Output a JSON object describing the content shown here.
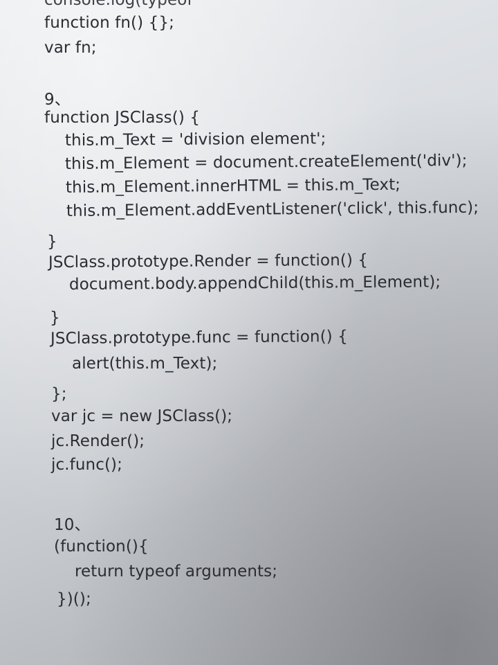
{
  "code_lines": [
    "console.log(typeof",
    "function fn() {};",
    "var fn;",
    "9、",
    "function JSClass() {",
    "this.m_Text = 'division element';",
    "this.m_Element = document.createElement('div');",
    "this.m_Element.innerHTML = this.m_Text;",
    "this.m_Element.addEventListener('click', this.func);",
    "}",
    "JSClass.prototype.Render = function() {",
    "document.body.appendChild(this.m_Element);",
    "}",
    "JSClass.prototype.func = function() {",
    "alert(this.m_Text);",
    "};",
    "var jc = new JSClass();",
    "jc.Render();",
    "jc.func();",
    "10、",
    "(function(){",
    "return typeof arguments;",
    "})();"
  ]
}
